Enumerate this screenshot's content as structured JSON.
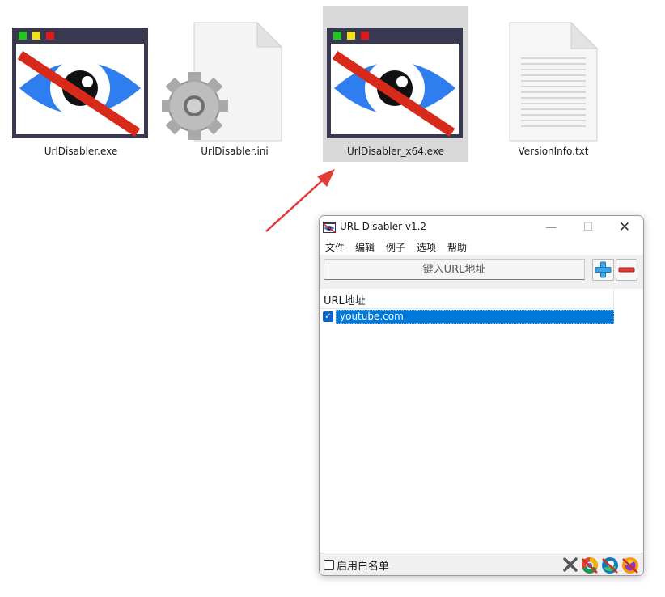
{
  "explorer": {
    "files": [
      {
        "name": "UrlDisabler.exe",
        "icon": "urldisabler-app-icon"
      },
      {
        "name": "UrlDisabler.ini",
        "icon": "settings-file-icon"
      },
      {
        "name": "UrlDisabler_x64.exe",
        "icon": "urldisabler-app-icon",
        "selected": true
      },
      {
        "name": "VersionInfo.txt",
        "icon": "text-file-icon"
      }
    ]
  },
  "window": {
    "title": "URL Disabler v1.2",
    "controls": {
      "minimize": "—",
      "maximize": "☐",
      "close": "✕"
    },
    "menu": [
      "文件",
      "编辑",
      "例子",
      "选项",
      "帮助"
    ],
    "url_input": {
      "placeholder": "键入URL地址",
      "value": ""
    },
    "list": {
      "header": "URL地址",
      "rows": [
        {
          "url": "youtube.com",
          "checked": true,
          "selected": true
        }
      ]
    },
    "status": {
      "whitelist_label": "启用白名单",
      "whitelist_checked": false,
      "browser_icons": [
        "close-x-icon",
        "chrome-disabled-icon",
        "edge-disabled-icon",
        "firefox-disabled-icon"
      ]
    }
  },
  "colors": {
    "accent": "#0078d7",
    "selection_bg": "#d9d9d9",
    "arrow": "#e53935"
  }
}
